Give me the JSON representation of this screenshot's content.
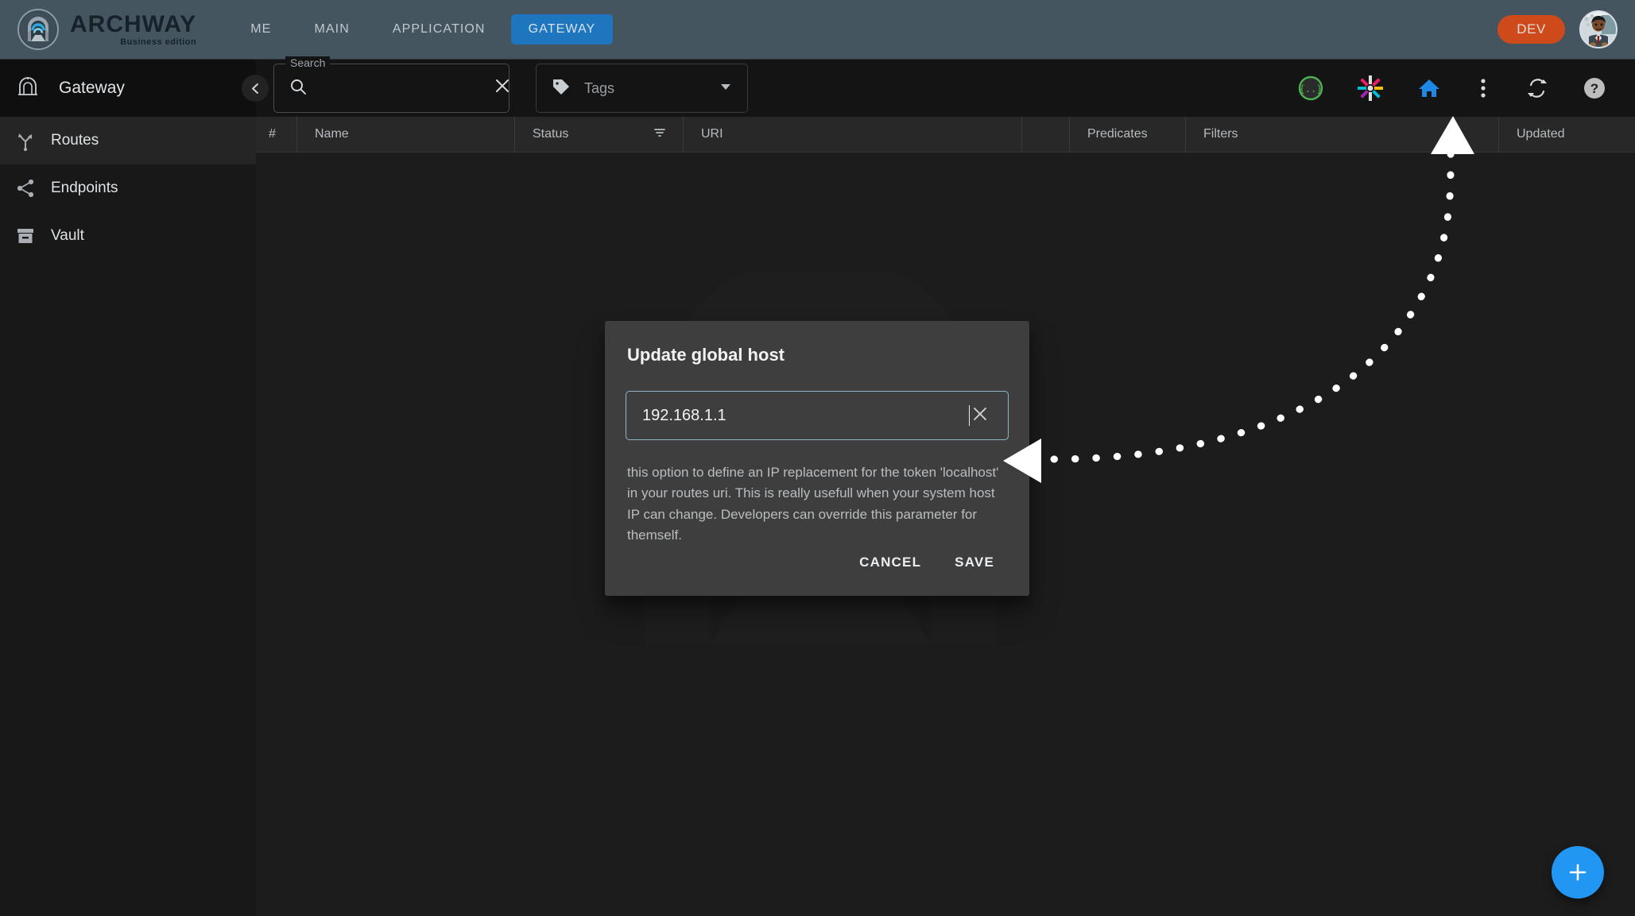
{
  "app": {
    "brand_name": "ARCHWAY",
    "brand_edition": "Business edition",
    "env_badge": "DEV"
  },
  "nav": {
    "items": [
      {
        "label": "ME",
        "active": false
      },
      {
        "label": "MAIN",
        "active": false
      },
      {
        "label": "APPLICATION",
        "active": false
      },
      {
        "label": "GATEWAY",
        "active": true
      }
    ]
  },
  "toolbar": {
    "page_title": "Gateway",
    "search": {
      "label": "Search",
      "value": "",
      "placeholder": ""
    },
    "tags": {
      "label": "Tags",
      "selected": ""
    },
    "icons": [
      {
        "name": "json-braces-icon",
        "title": ""
      },
      {
        "name": "pinwheel-icon",
        "title": ""
      },
      {
        "name": "home-icon",
        "title": ""
      },
      {
        "name": "more-vertical-icon",
        "title": ""
      },
      {
        "name": "sync-icon",
        "title": ""
      },
      {
        "name": "help-icon",
        "title": ""
      }
    ]
  },
  "sidebar": {
    "items": [
      {
        "label": "Routes",
        "icon": "route-fork-icon",
        "active": true
      },
      {
        "label": "Endpoints",
        "icon": "share-icon",
        "active": false
      },
      {
        "label": "Vault",
        "icon": "archive-icon",
        "active": false
      }
    ]
  },
  "table": {
    "columns": [
      {
        "key": "num",
        "label": "#"
      },
      {
        "key": "name",
        "label": "Name"
      },
      {
        "key": "status",
        "label": "Status"
      },
      {
        "key": "uri",
        "label": "URI"
      },
      {
        "key": "blank",
        "label": ""
      },
      {
        "key": "predicates",
        "label": "Predicates"
      },
      {
        "key": "filters",
        "label": "Filters"
      },
      {
        "key": "updated",
        "label": "Updated"
      }
    ],
    "rows": []
  },
  "dialog": {
    "title": "Update global host",
    "input_value": "192.168.1.1",
    "input_placeholder": "",
    "description": "this option to define an IP replacement for the token 'localhost' in your routes uri. This is really usefull when your system host IP can change. Developers can override this parameter for themself.",
    "cancel_label": "CANCEL",
    "save_label": "SAVE"
  },
  "fab": {
    "label": "+"
  },
  "colors": {
    "header_bg": "#445560",
    "accent_blue": "#1e76bf",
    "env_orange": "#cf4a1a",
    "fab_blue": "#2196f3",
    "dialog_bg": "#3e3e3e",
    "input_border": "#8fb4c9",
    "page_bg": "#1c1c1c"
  }
}
